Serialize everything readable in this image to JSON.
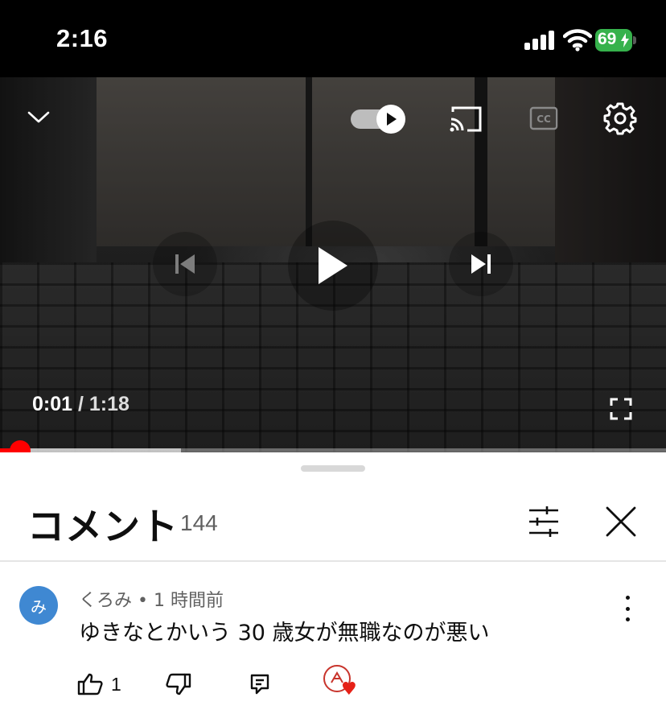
{
  "status_bar": {
    "time": "2:16",
    "battery": "69"
  },
  "video": {
    "current_time": "0:01",
    "separator": "/",
    "total_time": "1:18",
    "progress_fraction": 0.013,
    "icons": {
      "collapse": "chevron-down-icon",
      "autoplay": "autoplay-toggle",
      "cast": "cast-icon",
      "captions": "cc-icon",
      "settings": "gear-icon",
      "previous": "skip-previous-icon",
      "play": "play-icon",
      "next": "skip-next-icon",
      "fullscreen": "fullscreen-icon"
    }
  },
  "comments": {
    "title": "コメント",
    "count": "144",
    "items": [
      {
        "avatar_letter": "み",
        "author": "くろみ",
        "separator": "•",
        "time": "1 時間前",
        "text": "ゆきなとかいう 30 歳女が無職なのが悪い",
        "likes": "1",
        "creator_heart": true
      }
    ]
  },
  "colors": {
    "accent": "#ff0000",
    "avatar": "#3f88d2",
    "battery": "#36b24c"
  }
}
